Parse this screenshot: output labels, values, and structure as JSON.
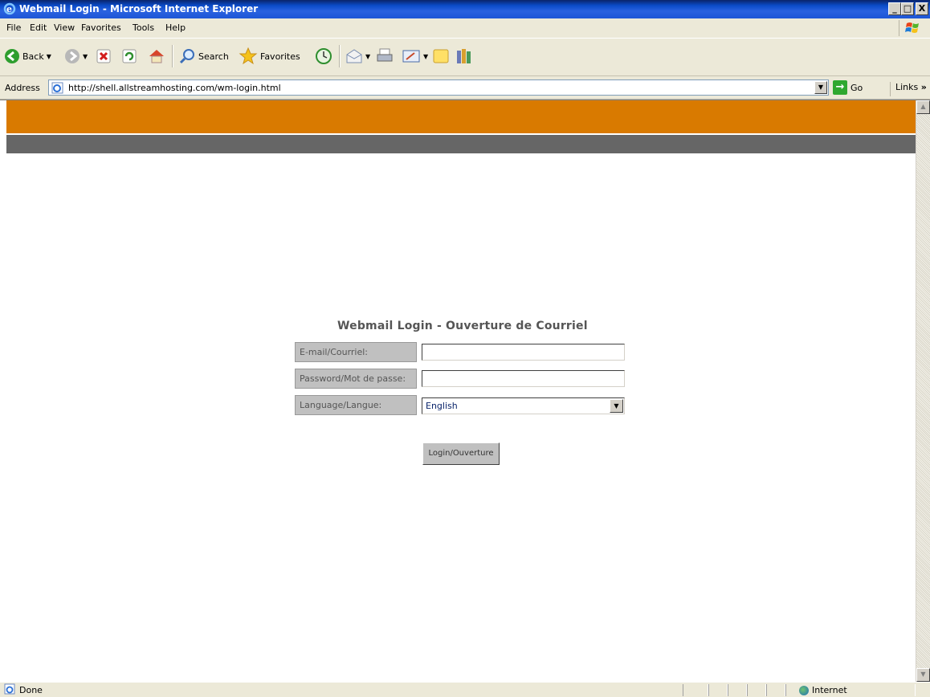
{
  "window": {
    "title": "Webmail Login - Microsoft Internet Explorer",
    "controls": [
      "_",
      "□",
      "X"
    ]
  },
  "menu": [
    "File",
    "Edit",
    "View",
    "Favorites",
    "Tools",
    "Help"
  ],
  "toolbar": {
    "back_label": "Back",
    "search_label": "Search",
    "favorites_label": "Favorites"
  },
  "address": {
    "label": "Address",
    "url": "http://shell.allstreamhosting.com/wm-login.html",
    "go_label": "Go",
    "links_label": "Links"
  },
  "page": {
    "heading": "Webmail Login - Ouverture de Courriel",
    "email_label": "E-mail/Courriel:",
    "email_value": "",
    "password_label": "Password/Mot de passe:",
    "password_value": "",
    "language_label": "Language/Langue:",
    "language_selected": "English",
    "login_button": "Login/Ouverture"
  },
  "colors": {
    "header_band": "#D97A00",
    "sub_band": "#666666"
  },
  "status": {
    "text": "Done",
    "zone": "Internet"
  }
}
